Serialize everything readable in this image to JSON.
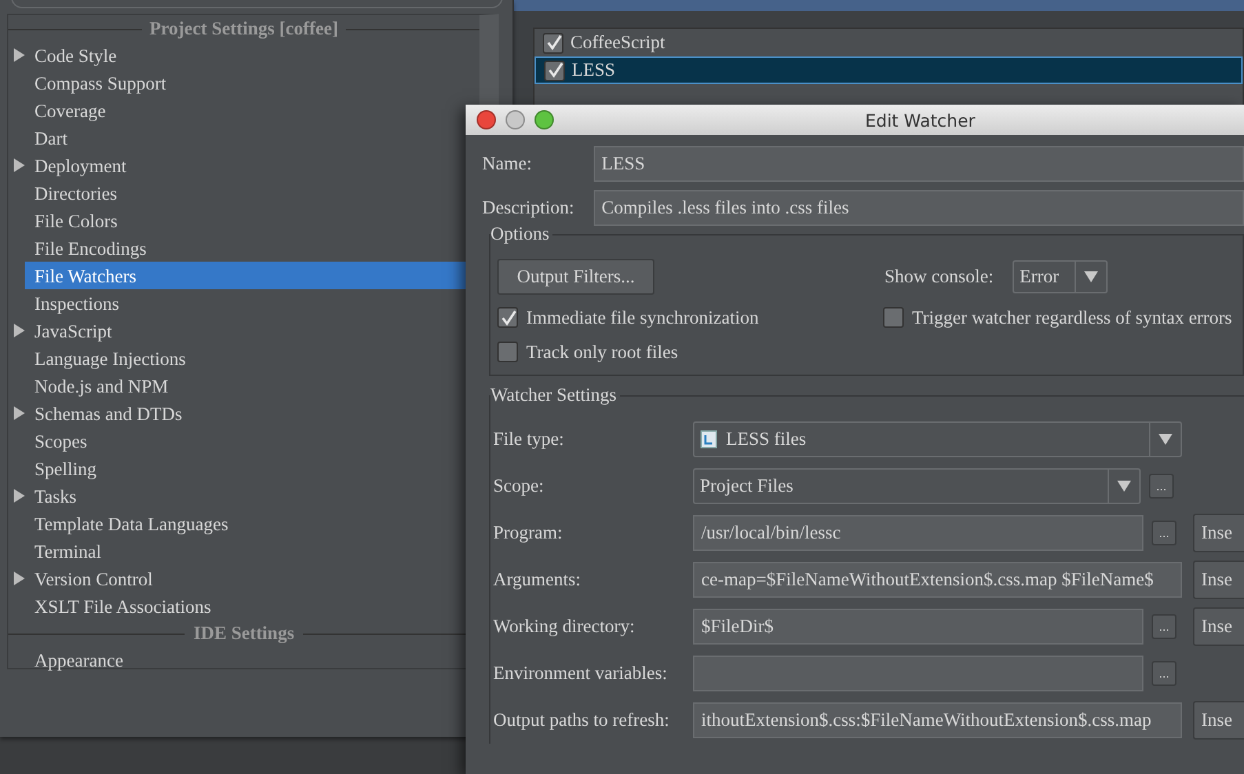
{
  "settings_tree": {
    "sections": [
      {
        "title": "Project Settings [coffee]",
        "items": [
          {
            "label": "Code Style",
            "expandable": true,
            "selected": false
          },
          {
            "label": "Compass Support",
            "expandable": false,
            "selected": false
          },
          {
            "label": "Coverage",
            "expandable": false,
            "selected": false
          },
          {
            "label": "Dart",
            "expandable": false,
            "selected": false
          },
          {
            "label": "Deployment",
            "expandable": true,
            "selected": false
          },
          {
            "label": "Directories",
            "expandable": false,
            "selected": false
          },
          {
            "label": "File Colors",
            "expandable": false,
            "selected": false
          },
          {
            "label": "File Encodings",
            "expandable": false,
            "selected": false
          },
          {
            "label": "File Watchers",
            "expandable": false,
            "selected": true
          },
          {
            "label": "Inspections",
            "expandable": false,
            "selected": false
          },
          {
            "label": "JavaScript",
            "expandable": true,
            "selected": false
          },
          {
            "label": "Language Injections",
            "expandable": false,
            "selected": false
          },
          {
            "label": "Node.js and NPM",
            "expandable": false,
            "selected": false
          },
          {
            "label": "Schemas and DTDs",
            "expandable": true,
            "selected": false
          },
          {
            "label": "Scopes",
            "expandable": false,
            "selected": false
          },
          {
            "label": "Spelling",
            "expandable": false,
            "selected": false
          },
          {
            "label": "Tasks",
            "expandable": true,
            "selected": false
          },
          {
            "label": "Template Data Languages",
            "expandable": false,
            "selected": false
          },
          {
            "label": "Terminal",
            "expandable": false,
            "selected": false
          },
          {
            "label": "Version Control",
            "expandable": true,
            "selected": false
          },
          {
            "label": "XSLT File Associations",
            "expandable": false,
            "selected": false
          }
        ]
      },
      {
        "title": "IDE Settings",
        "items": [
          {
            "label": "Appearance",
            "expandable": false,
            "selected": false
          }
        ]
      }
    ]
  },
  "watchers": [
    {
      "name": "CoffeeScript",
      "checked": true,
      "selected": false
    },
    {
      "name": "LESS",
      "checked": true,
      "selected": true
    }
  ],
  "dialog": {
    "title": "Edit Watcher",
    "fields": [
      {
        "label": "Name:",
        "value": "LESS"
      },
      {
        "label": "Description:",
        "value": "Compiles .less files into .css files"
      }
    ],
    "options": {
      "title": "Options",
      "filters_button": "Output Filters...",
      "console_label": "Show console:",
      "console_value": "Error",
      "checkboxes": [
        {
          "label": "Immediate file synchronization",
          "checked": true
        },
        {
          "label": "Trigger watcher regardless of syntax errors",
          "checked": false
        },
        {
          "label": "Track only root files",
          "checked": false
        }
      ]
    },
    "watcher_settings": {
      "title": "Watcher Settings",
      "rows": [
        {
          "kind": "combo",
          "label": "File type:",
          "value": "LESS files",
          "file_icon": true
        },
        {
          "kind": "combo",
          "label": "Scope:",
          "value": "Project Files",
          "browse_button": "..."
        },
        {
          "kind": "text",
          "label": "Program:",
          "value": "/usr/local/bin/lessc",
          "browse_button": "...",
          "insert_button": "Inse"
        },
        {
          "kind": "text",
          "label": "Arguments:",
          "value": "ce-map=$FileNameWithoutExtension$.css.map $FileName$",
          "insert_button": "Inse"
        },
        {
          "kind": "text",
          "label": "Working directory:",
          "value": "$FileDir$",
          "browse_button": "...",
          "insert_button": "Inse"
        },
        {
          "kind": "text",
          "label": "Environment variables:",
          "value": "",
          "browse_button": "..."
        },
        {
          "kind": "text",
          "label": "Output paths to refresh:",
          "value": "ithoutExtension$.css:$FileNameWithoutExtension$.css.map",
          "insert_button": "Inse"
        }
      ]
    }
  }
}
